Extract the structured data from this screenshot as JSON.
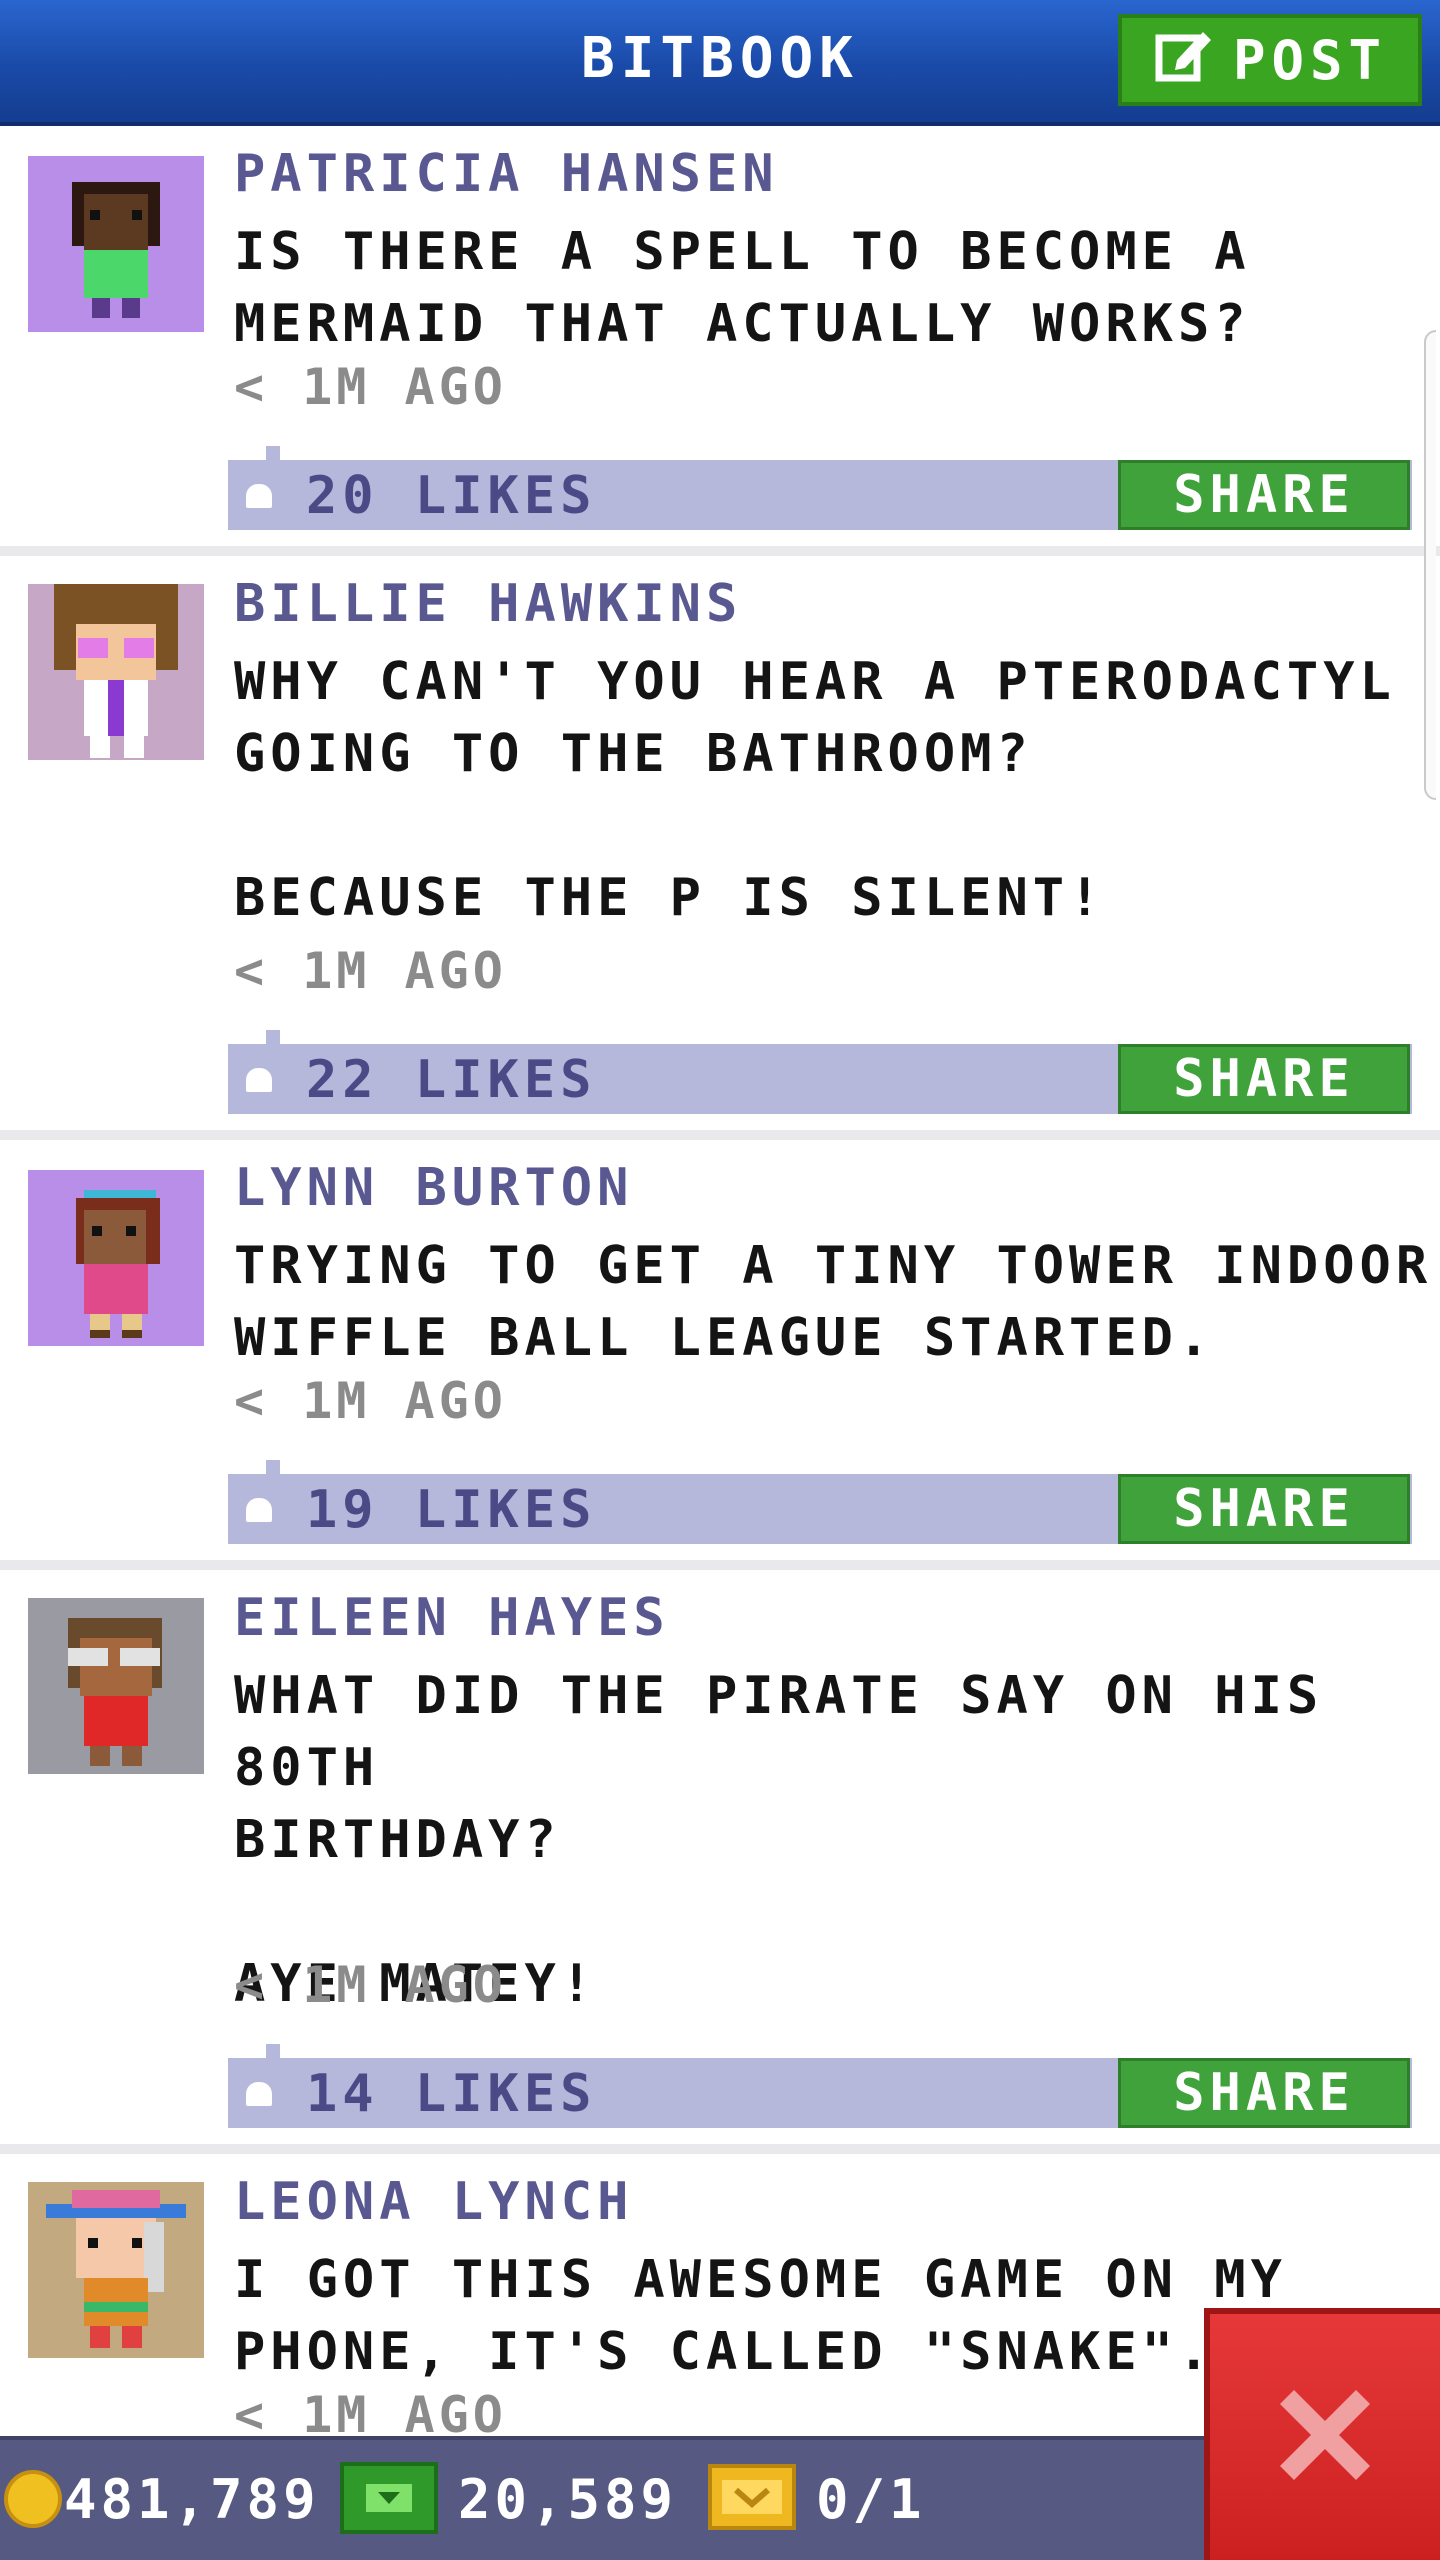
{
  "header": {
    "title": "BITBOOK",
    "post_label": "POST"
  },
  "posts": [
    {
      "author": "PATRICIA HANSEN",
      "text": "IS THERE A SPELL TO BECOME A\nMERMAID THAT ACTUALLY WORKS?",
      "time": "< 1M AGO",
      "likes": "20 LIKES",
      "share": "SHARE"
    },
    {
      "author": "BILLIE HAWKINS",
      "text": "WHY CAN'T YOU HEAR A PTERODACTYL\nGOING TO THE BATHROOM?\n\nBECAUSE THE P IS SILENT!",
      "time": "< 1M AGO",
      "likes": "22 LIKES",
      "share": "SHARE"
    },
    {
      "author": "LYNN BURTON",
      "text": "TRYING TO GET A TINY TOWER INDOOR\nWIFFLE BALL LEAGUE STARTED.",
      "time": "< 1M AGO",
      "likes": "19 LIKES",
      "share": "SHARE"
    },
    {
      "author": "EILEEN HAYES",
      "text": "WHAT DID THE PIRATE SAY ON HIS 80TH\nBIRTHDAY?\n\nAYE MATEY!",
      "time": "< 1M AGO",
      "likes": "14 LIKES",
      "share": "SHARE"
    },
    {
      "author": "LEONA LYNCH",
      "text": "I GOT THIS AWESOME GAME ON MY\nPHONE, IT'S CALLED \"SNAKE\".",
      "time": "< 1M AGO",
      "likes": "",
      "share": ""
    }
  ],
  "status_bar": {
    "coins": "481,789",
    "bux": "20,589",
    "vip": "0/1"
  },
  "colors": {
    "header_blue": "#1a4aa8",
    "post_green": "#3aa521",
    "author_purple": "#5a5890",
    "likes_bar": "#b5b8da",
    "close_red": "#d82a2a",
    "bottom_bar": "#565a82"
  }
}
